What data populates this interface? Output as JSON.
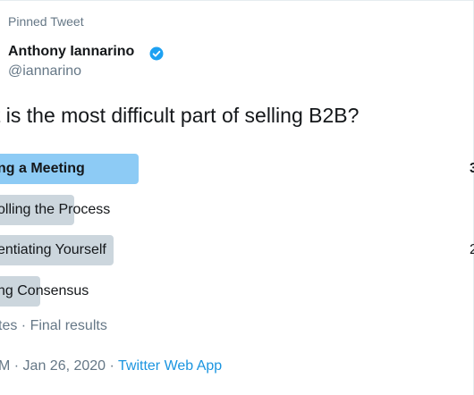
{
  "tweet": {
    "pinned_label": "Pinned Tweet",
    "author_name": "Anthony Iannarino",
    "author_handle": "@iannarino",
    "verified_icon": "verified-badge-icon",
    "question": "t is the most difficult part of selling B2B?",
    "poll": {
      "options": [
        {
          "label": "ng a Meeting",
          "percent": "3",
          "bar_fraction": 0.28,
          "winner": true
        },
        {
          "label": "olling the Process",
          "percent": "",
          "bar_fraction": 0.15,
          "winner": false
        },
        {
          "label": "entiating Yourself",
          "percent": "2",
          "bar_fraction": 0.23,
          "winner": false
        },
        {
          "label": "ng Consensus",
          "percent": "",
          "bar_fraction": 0.08,
          "winner": false
        }
      ],
      "status": "tes · Final results"
    },
    "timestamp": "M · Jan 26, 2020 · ",
    "source_link": "Twitter Web App"
  },
  "colors": {
    "winner_bar": "#8dcbf5",
    "other_bar": "#ccd6dd",
    "muted_text": "#657786",
    "link": "#1b95e0",
    "verified": "#1da1f2"
  }
}
